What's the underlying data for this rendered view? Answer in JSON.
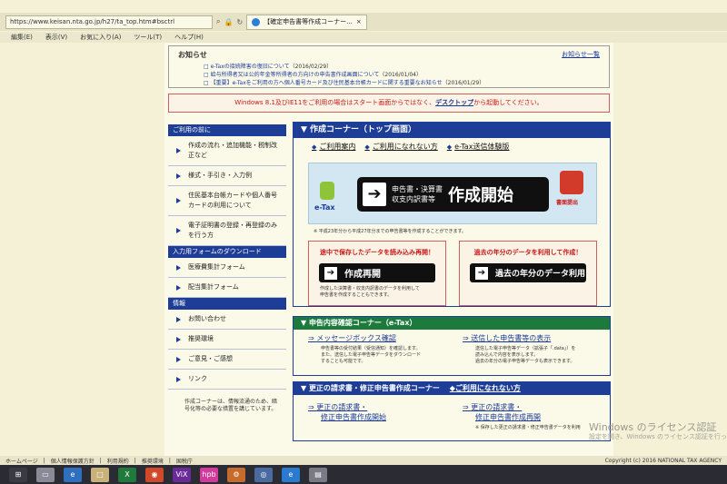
{
  "browser": {
    "url": "https://www.keisan.nta.go.jp/h27/ta_top.htm#bsctrl",
    "tab_title": "【確定申告書等作成コーナー...",
    "menu": [
      "編集(E)",
      "表示(V)",
      "お気に入り(A)",
      "ツール(T)",
      "ヘルプ(H)"
    ]
  },
  "notice": {
    "title": "お知らせ",
    "all_link": "お知らせ一覧",
    "items": [
      {
        "text": "e-Taxの接続障害の復旧について",
        "date": "（2016/02/29）"
      },
      {
        "text": "給与所得者又は公的年金等所得者の方向けの申告書作成画面について",
        "date": "（2016/01/04）"
      },
      {
        "text": "【重要】e-Taxをご利用の方へ個人番号カード及び住民基本台帳カードに関する重要なお知らせ",
        "date": "（2016/01/29）"
      }
    ]
  },
  "win_banner": {
    "pre": "Windows 8.1及びIE11をご利用の場合はスタート画面からではなく、",
    "link": "デスクトップ",
    "post": "から起動してください。"
  },
  "sidebar": {
    "sections": [
      {
        "head": "ご利用の前に",
        "items": [
          "作成の流れ・追加機能・税制改正など",
          "様式・手引き・入力例",
          "住民基本台帳カードや個人番号カードの利用について",
          "電子証明書の登録・再登録のみを行う方"
        ]
      },
      {
        "head": "入力用フォームのダウンロード",
        "items": [
          "医療費集計フォーム",
          "配当集計フォーム"
        ]
      },
      {
        "head": "情報",
        "items": [
          "お問い合わせ",
          "推奨環境",
          "ご意見・ご感想",
          "リンク"
        ]
      }
    ],
    "note": "作成コーナーは、情報流通のため、暗号化等の必要な措置を講じています。"
  },
  "main": {
    "corner": {
      "title": "▼ 作成コーナー（トップ画面）",
      "subnav": [
        "ご利用案内",
        "ご利用になれない方",
        "e-Tax送信体験版"
      ],
      "hero_small_1": "申告書・決算書",
      "hero_small_2": "収支内訳書等",
      "hero_big": "作成開始",
      "hero_arrow": "➔",
      "etax": "e-Tax",
      "submit_label": "書面提出",
      "hero_note": "※ 平成23年分から平成27年分までの申告書等を作成することができます。"
    },
    "card_left": {
      "title": "途中で保存したデータを読み込み再開！",
      "button": "作成再開",
      "note_1": "作成した決算書・収支内訳書のデータを利用して",
      "note_2": "申告書を作成することもできます。"
    },
    "card_right": {
      "title": "過去の年分のデータを利用して作成！",
      "button": "過去の年分のデータ利用"
    },
    "confirm": {
      "title": "▼ 申告内容確認コーナー（e-Tax）",
      "left_link": "メッセージボックス確認",
      "left_desc": [
        "申告書等の受付結果（受信通知）を確認します。",
        "また、送信した電子申告等データをダウンロード",
        "することも可能です。"
      ],
      "right_link": "送信した申告書等の表示",
      "right_desc": [
        "送信した電子申告等データ（拡張子「.data」）を",
        "読み込んで内容を表示します。",
        "過去の年分の電子申告等データも表示できます。"
      ]
    },
    "amend": {
      "title": "▼ 更正の請求書・修正申告書作成コーナー",
      "title_link": "◆ご利用になれない方",
      "left_link_1": "更正の請求書・",
      "left_link_2": "修正申告書作成開始",
      "right_link_1": "更正の請求書・",
      "right_link_2": "修正申告書作成再開",
      "right_note": "※ 保存した更正の請求書・修正申告書データを利用"
    }
  },
  "watermark": {
    "line1": "Windows のライセンス認証",
    "line2": "設定を開き、Windows のライセンス認証を行ってください。"
  },
  "footer": {
    "links": [
      "ホームページ",
      "個人情報保護方針",
      "利用規約",
      "推奨環境",
      "国税庁"
    ],
    "copyright": "Copyright (c) 2016 NATIONAL TAX AGENCY"
  },
  "taskbar": {
    "apps": [
      "⊞",
      "▭",
      "e",
      "□",
      "X",
      "◉",
      "ViX",
      "hpb",
      "⚙",
      "◎",
      "e",
      "▤"
    ]
  }
}
